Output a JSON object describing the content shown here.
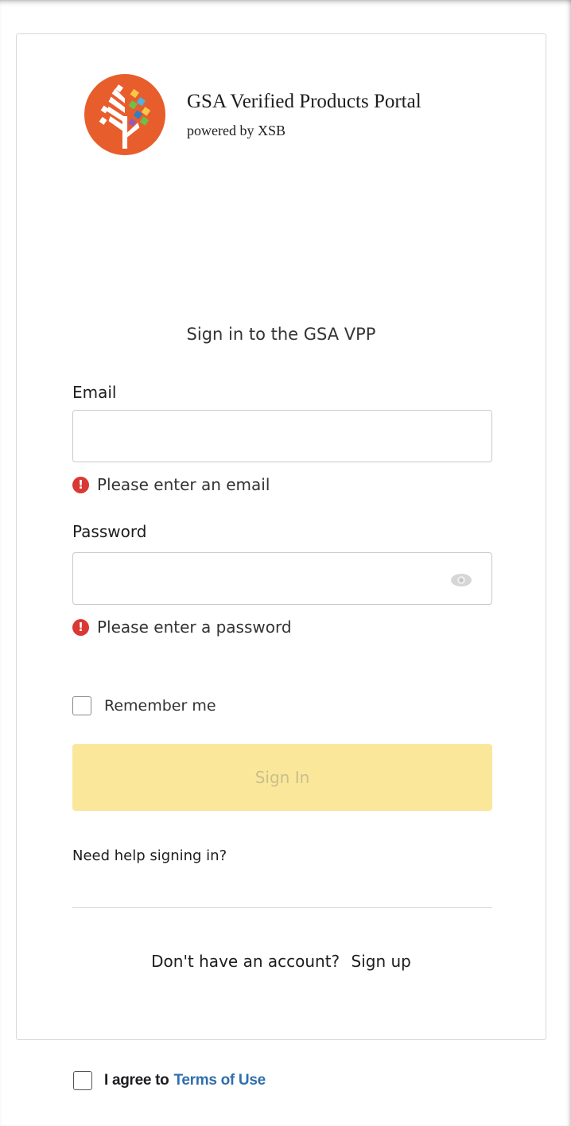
{
  "brand": {
    "title": "GSA Verified Products Portal",
    "subtitle": "powered by XSB",
    "logo_icon": "tree-logo-icon"
  },
  "form": {
    "heading": "Sign in to the GSA VPP",
    "email": {
      "label": "Email",
      "value": "",
      "error": "Please enter an email"
    },
    "password": {
      "label": "Password",
      "value": "",
      "error": "Please enter a password",
      "toggle_icon": "eye-icon"
    },
    "remember_label": "Remember me",
    "signin_label": "Sign In",
    "help_link": "Need help signing in?",
    "signup_prompt": "Don't have an account?",
    "signup_link": "Sign up"
  },
  "terms": {
    "prefix": "I agree to",
    "link": "Terms of Use"
  },
  "colors": {
    "logo": "#e85d2c",
    "error": "#d93934",
    "signin_button": "#fbe79a",
    "terms_link": "#2f6faa"
  }
}
